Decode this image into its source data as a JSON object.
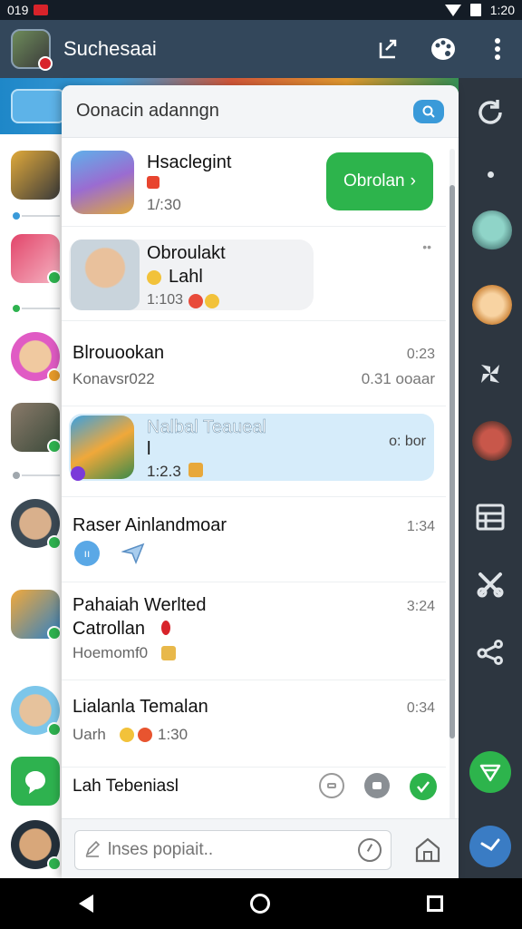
{
  "status_bar": {
    "left_text": "019",
    "time": "1:20"
  },
  "app_bar": {
    "title": "Suchesaai"
  },
  "panel": {
    "title": "Oonacin adanngn"
  },
  "chats": [
    {
      "name": "Hsaclegint",
      "time": "1/:30",
      "action_label": "Obrolan"
    },
    {
      "name": "Obroulakt",
      "line2": "Lahl",
      "time": "1:103"
    },
    {
      "name": "Blrouookan",
      "sub": "Konavsr022",
      "time_top": "0:23",
      "time_bottom": "0.31 ooaar"
    },
    {
      "name": "Nalbal Teaueal",
      "line2": "l",
      "sub": "1:2.3",
      "time": "o: bor"
    },
    {
      "name": "Raser Ainlandmoar",
      "time": "1:34"
    },
    {
      "name": "Pahaiah Werlted",
      "line2": "Catrollan",
      "sub": "Hoemomf0",
      "time": "3:24"
    },
    {
      "name": "Lialanla Temalan",
      "sub": "Uarh",
      "time_bottom": "1:30",
      "time": "0:34"
    },
    {
      "name": "Lah Tebeniasl"
    }
  ],
  "compose": {
    "placeholder": "lnses popiait.."
  },
  "colors": {
    "accent_blue": "#3a9ad9",
    "accent_green": "#2db44c",
    "app_bar": "#33475b",
    "rail": "#2d3640"
  }
}
